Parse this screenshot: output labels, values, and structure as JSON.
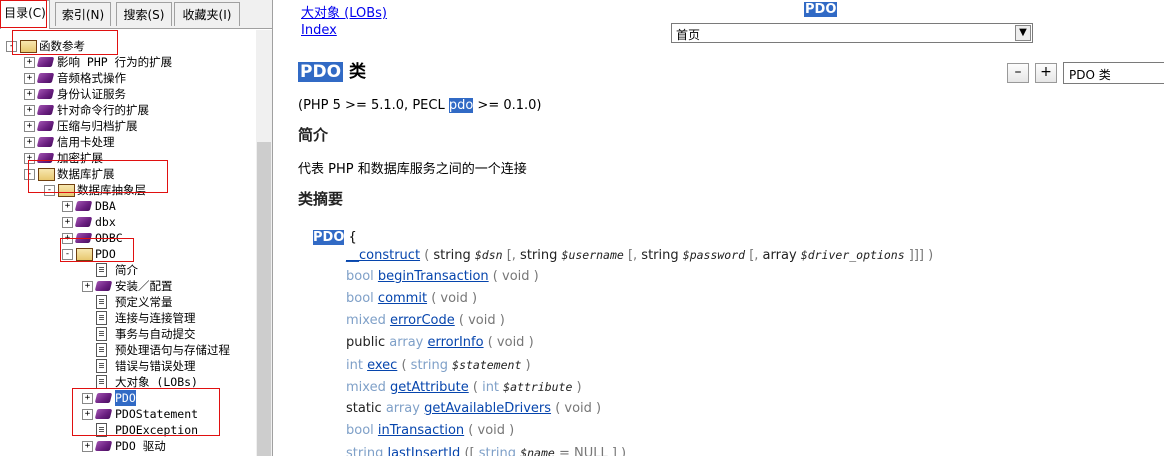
{
  "tabs": [
    "目录(C)",
    "索引(N)",
    "搜索(S)",
    "收藏夹(I)"
  ],
  "tree": [
    {
      "label": "函数参考",
      "x": 6,
      "depth": 0,
      "icon": "book-open",
      "exp": "-"
    },
    {
      "label": "影响 PHP 行为的扩展",
      "depth": 1,
      "icon": "book",
      "exp": "+"
    },
    {
      "label": "音频格式操作",
      "depth": 1,
      "icon": "book",
      "exp": "+"
    },
    {
      "label": "身份认证服务",
      "depth": 1,
      "icon": "book",
      "exp": "+"
    },
    {
      "label": "针对命令行的扩展",
      "depth": 1,
      "icon": "book",
      "exp": "+"
    },
    {
      "label": "压缩与归档扩展",
      "depth": 1,
      "icon": "book",
      "exp": "+"
    },
    {
      "label": "信用卡处理",
      "depth": 1,
      "icon": "book",
      "exp": "+"
    },
    {
      "label": "加密扩展",
      "depth": 1,
      "icon": "book",
      "exp": "+"
    },
    {
      "label": "数据库扩展",
      "depth": 1,
      "icon": "book-open",
      "exp": "-"
    },
    {
      "label": "数据库抽象层",
      "depth": 2,
      "icon": "book-open",
      "exp": "-"
    },
    {
      "label": "DBA",
      "depth": 3,
      "icon": "book",
      "exp": "+"
    },
    {
      "label": "dbx",
      "depth": 3,
      "icon": "book",
      "exp": "+"
    },
    {
      "label": "ODBC",
      "depth": 3,
      "icon": "book",
      "exp": "+"
    },
    {
      "label": "PDO",
      "depth": 3,
      "icon": "book-open",
      "exp": "-"
    },
    {
      "label": "简介",
      "depth": 4,
      "icon": "page",
      "exp": ""
    },
    {
      "label": "安装／配置",
      "depth": 4,
      "icon": "book",
      "exp": "+"
    },
    {
      "label": "预定义常量",
      "depth": 4,
      "icon": "page",
      "exp": ""
    },
    {
      "label": "连接与连接管理",
      "depth": 4,
      "icon": "page",
      "exp": ""
    },
    {
      "label": "事务与自动提交",
      "depth": 4,
      "icon": "page",
      "exp": ""
    },
    {
      "label": "预处理语句与存储过程",
      "depth": 4,
      "icon": "page",
      "exp": ""
    },
    {
      "label": "错误与错误处理",
      "depth": 4,
      "icon": "page",
      "exp": ""
    },
    {
      "label": "大对象 (LOBs)",
      "depth": 4,
      "icon": "page",
      "exp": ""
    },
    {
      "label": "PDO",
      "depth": 4,
      "icon": "book",
      "exp": "+",
      "selected": true
    },
    {
      "label": "PDOStatement",
      "depth": 4,
      "icon": "book",
      "exp": "+"
    },
    {
      "label": "PDOException",
      "depth": 4,
      "icon": "page",
      "exp": ""
    },
    {
      "label": "PDO 驱动",
      "depth": 4,
      "icon": "book",
      "exp": "+"
    }
  ],
  "nav": {
    "prev_link": "大对象 (LOBs)",
    "index_link": "Index",
    "current": "PDO",
    "select_value": "首页"
  },
  "toolbar": {
    "minus": "–",
    "plus": "+",
    "search_value": "PDO 类"
  },
  "content": {
    "title_hl": "PDO",
    "title_rest": " 类",
    "version_pre": "(PHP 5 >= 5.1.0, PECL ",
    "version_hl": "pdo",
    "version_post": " >= 0.1.0)",
    "intro_heading": "简介",
    "intro_text": "代表 PHP 和数据库服务之间的一个连接",
    "synopsis_heading": "类摘要",
    "class_name": "PDO",
    "brace": " {"
  },
  "methods": [
    {
      "mod": "",
      "ret": "",
      "name": "__construct",
      "args": [
        [
          "( ",
          "string",
          "$dsn",
          ""
        ],
        [
          " [, ",
          "string",
          "$username",
          ""
        ],
        [
          " [, ",
          "string",
          "$password",
          ""
        ],
        [
          " [, ",
          "array",
          "$driver_options",
          " ]]] )"
        ]
      ]
    },
    {
      "mod": "",
      "ret": "bool",
      "name": "beginTransaction",
      "plain": "( void )"
    },
    {
      "mod": "",
      "ret": "bool",
      "name": "commit",
      "plain": "( void )"
    },
    {
      "mod": "",
      "ret": "mixed",
      "name": "errorCode",
      "plain": "( void )"
    },
    {
      "mod": "public",
      "ret": "array",
      "name": "errorInfo",
      "plain": "( void )"
    },
    {
      "mod": "",
      "ret": "int",
      "name": "exec",
      "args": [
        [
          "( ",
          "string",
          "$statement",
          " )"
        ]
      ]
    },
    {
      "mod": "",
      "ret": "mixed",
      "name": "getAttribute",
      "args": [
        [
          "( ",
          "int",
          "$attribute",
          " )"
        ]
      ]
    },
    {
      "mod": "static",
      "ret": "array",
      "name": "getAvailableDrivers",
      "plain": "( void )"
    },
    {
      "mod": "",
      "ret": "bool",
      "name": "inTransaction",
      "plain": "( void )"
    },
    {
      "mod": "",
      "ret": "string",
      "name": "lastInsertId",
      "args": [
        [
          "([ ",
          "string",
          "$name",
          " = NULL ] )"
        ]
      ]
    }
  ]
}
